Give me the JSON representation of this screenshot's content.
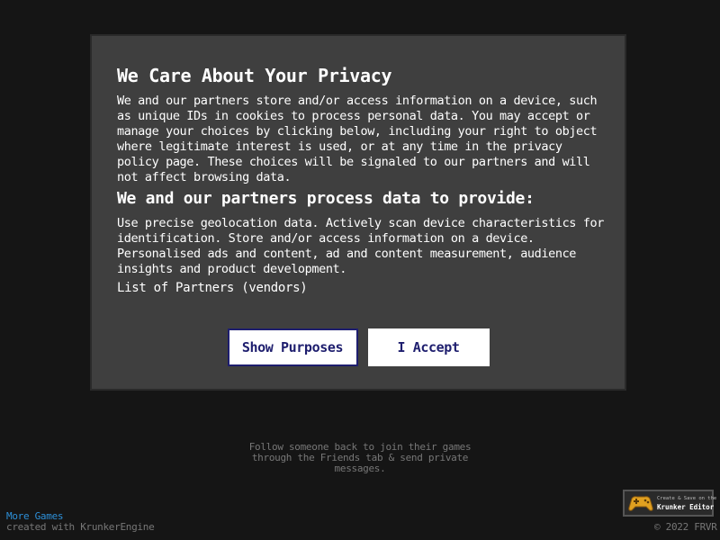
{
  "dialog": {
    "title": "We Care About Your Privacy",
    "body": "We and our partners store and/or access information on a device, such as unique IDs in cookies to process personal data. You may accept or manage your choices by clicking below, including your right to object where legitimate interest is used, or at any time in the privacy policy page. These choices will be signaled to our partners and will not affect browsing data.",
    "subtitle": "We and our partners process data to provide:",
    "purposes": "Use precise geolocation data. Actively scan device characteristics for identification. Store and/or access information on a device. Personalised ads and content, ad and content measurement, audience insights and product development.",
    "partners_link": "List of Partners (vendors)",
    "show_purposes_label": "Show Purposes",
    "accept_label": "I Accept"
  },
  "tip": "Follow someone back to join their games through the Friends tab & send private messages.",
  "footer": {
    "more_games": "More Games",
    "engine_credit": "created with KrunkerEngine",
    "editor_badge_small": "Create & Save on the",
    "editor_badge_big": "Krunker Editor",
    "copyright": "© 2022 FRVR"
  },
  "colors": {
    "background": "#151515",
    "dialog_bg": "#3f3f3f",
    "button_text": "#1e1e6e",
    "link_blue": "#2d8fd8",
    "muted_text": "#777777"
  },
  "icons": {
    "editor_badge_icon": "gamepad-icon"
  }
}
